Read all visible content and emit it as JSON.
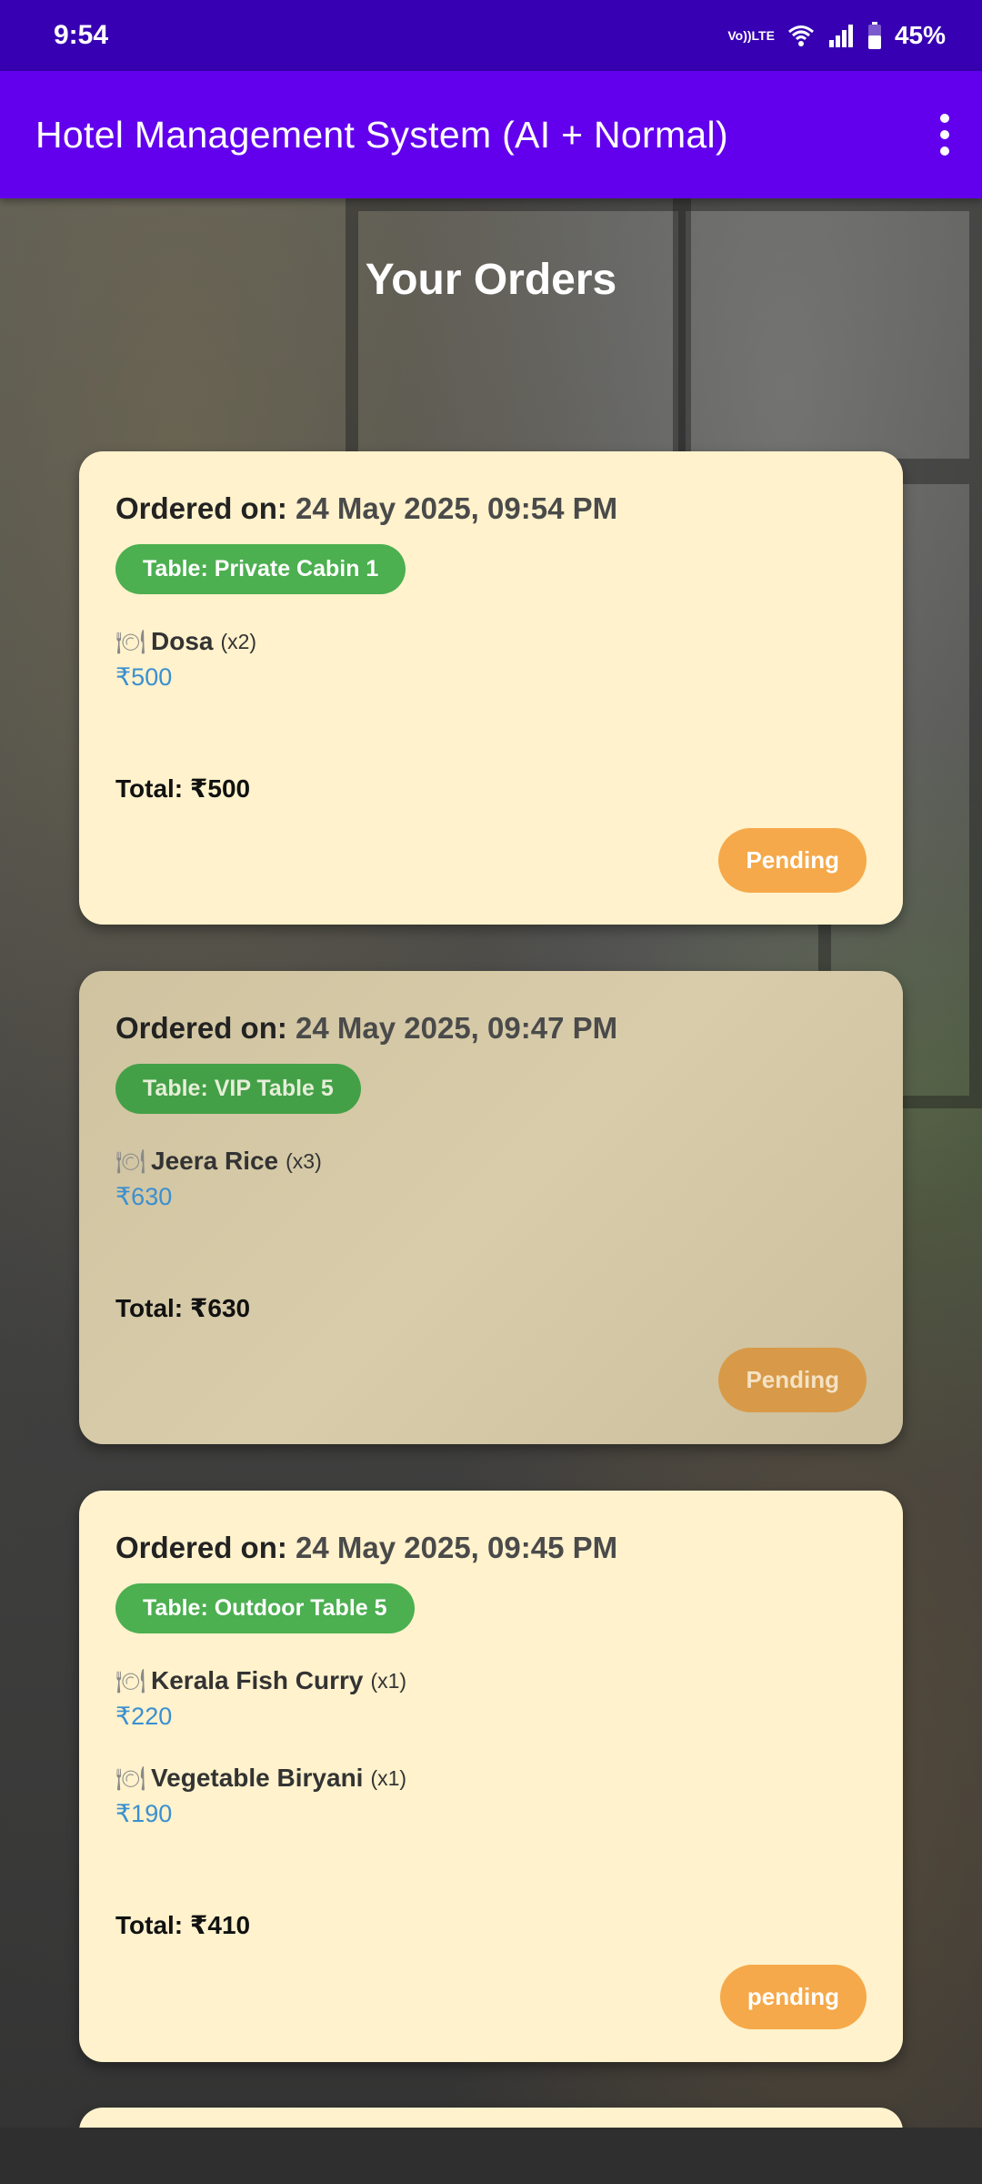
{
  "status_bar": {
    "time": "9:54",
    "volte_top": "Vo))",
    "volte_bottom": "LTE",
    "battery": "45%",
    "icons": [
      "volte-icon",
      "wifi-icon",
      "signal-icon",
      "battery-icon"
    ]
  },
  "app_bar": {
    "title": "Hotel Management System (AI + Normal)",
    "menu_icon": "more-vert-icon"
  },
  "page": {
    "heading": "Your Orders"
  },
  "orders": [
    {
      "ordered_label": "Ordered on:",
      "ordered_on": "24 May 2025, 09:54 PM",
      "table": "Table: Private Cabin 1",
      "items": [
        {
          "name": "Dosa",
          "qty": "(x2)",
          "price": "₹500"
        }
      ],
      "total": "Total: ₹500",
      "status": "Pending"
    },
    {
      "ordered_label": "Ordered on:",
      "ordered_on": "24 May 2025, 09:47 PM",
      "table": "Table: VIP Table 5",
      "items": [
        {
          "name": "Jeera Rice",
          "qty": "(x3)",
          "price": "₹630"
        }
      ],
      "total": "Total: ₹630",
      "status": "Pending"
    },
    {
      "ordered_label": "Ordered on:",
      "ordered_on": "24 May 2025, 09:45 PM",
      "table": "Table: Outdoor Table 5",
      "items": [
        {
          "name": "Kerala Fish Curry",
          "qty": "(x1)",
          "price": "₹220"
        },
        {
          "name": "Vegetable Biryani",
          "qty": "(x1)",
          "price": "₹190"
        }
      ],
      "total": "Total: ₹410",
      "status": "pending"
    }
  ],
  "colors": {
    "status_bar": "#3700b3",
    "app_bar": "#6200ee",
    "card": "#fff2cc",
    "table_pill": "#4caf50",
    "status_pill": "#f5a94a",
    "price": "#3a8fd1"
  }
}
